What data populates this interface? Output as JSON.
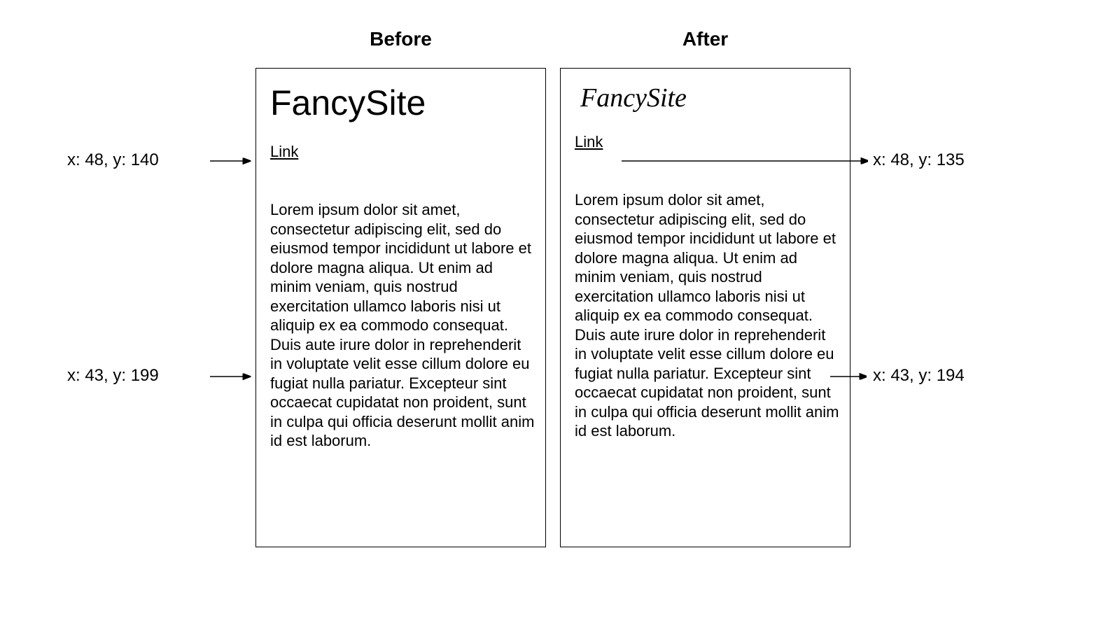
{
  "titles": {
    "before": "Before",
    "after": "After"
  },
  "site_name": "FancySite",
  "link_text": "Link",
  "body_text": "Lorem ipsum dolor sit amet, consectetur adipiscing elit, sed do eiusmod tempor incididunt ut labore et dolore magna aliqua. Ut enim ad minim veniam, quis nostrud exercitation ullamco laboris nisi ut aliquip ex ea commodo consequat. Duis aute irure dolor in reprehenderit in voluptate velit esse cillum dolore eu fugiat nulla pariatur. Excepteur sint occaecat cupidatat non proident, sunt in culpa qui officia deserunt mollit anim id est laborum.",
  "coords": {
    "before_link": "x: 48, y: 140",
    "before_body": "x: 43, y: 199",
    "after_link": "x: 48, y: 135",
    "after_body": "x: 43, y: 194"
  }
}
